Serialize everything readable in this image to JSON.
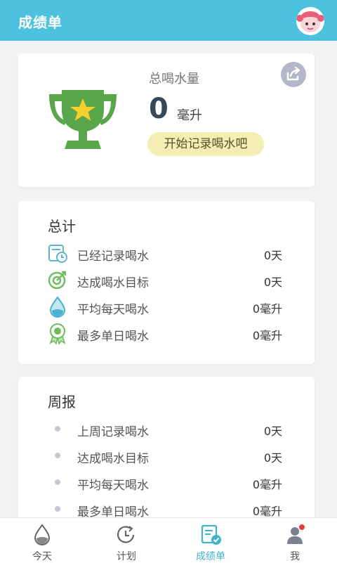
{
  "header": {
    "title": "成绩单"
  },
  "summary": {
    "label": "总喝水量",
    "value": "0",
    "unit": "毫升",
    "cta": "开始记录喝水吧"
  },
  "total": {
    "title": "总计",
    "rows": [
      {
        "label": "已经记录喝水",
        "value": "0天",
        "icon": "calendar-clock-icon"
      },
      {
        "label": "达成喝水目标",
        "value": "0天",
        "icon": "target-icon"
      },
      {
        "label": "平均每天喝水",
        "value": "0毫升",
        "icon": "water-drop-icon"
      },
      {
        "label": "最多单日喝水",
        "value": "0毫升",
        "icon": "medal-icon"
      }
    ]
  },
  "weekly": {
    "title": "周报",
    "rows": [
      {
        "label": "上周记录喝水",
        "value": "0天"
      },
      {
        "label": "达成喝水目标",
        "value": "0天"
      },
      {
        "label": "平均每天喝水",
        "value": "0毫升"
      },
      {
        "label": "最多单日喝水",
        "value": "0毫升"
      }
    ]
  },
  "tabs": [
    {
      "label": "今天",
      "icon": "water-drop-icon"
    },
    {
      "label": "计划",
      "icon": "clock-icon"
    },
    {
      "label": "成绩单",
      "icon": "report-check-icon",
      "active": true
    },
    {
      "label": "我",
      "icon": "profile-icon"
    }
  ],
  "colors": {
    "accent": "#4cc2df",
    "trophy": "#5aa64a",
    "star": "#f6d02f"
  }
}
